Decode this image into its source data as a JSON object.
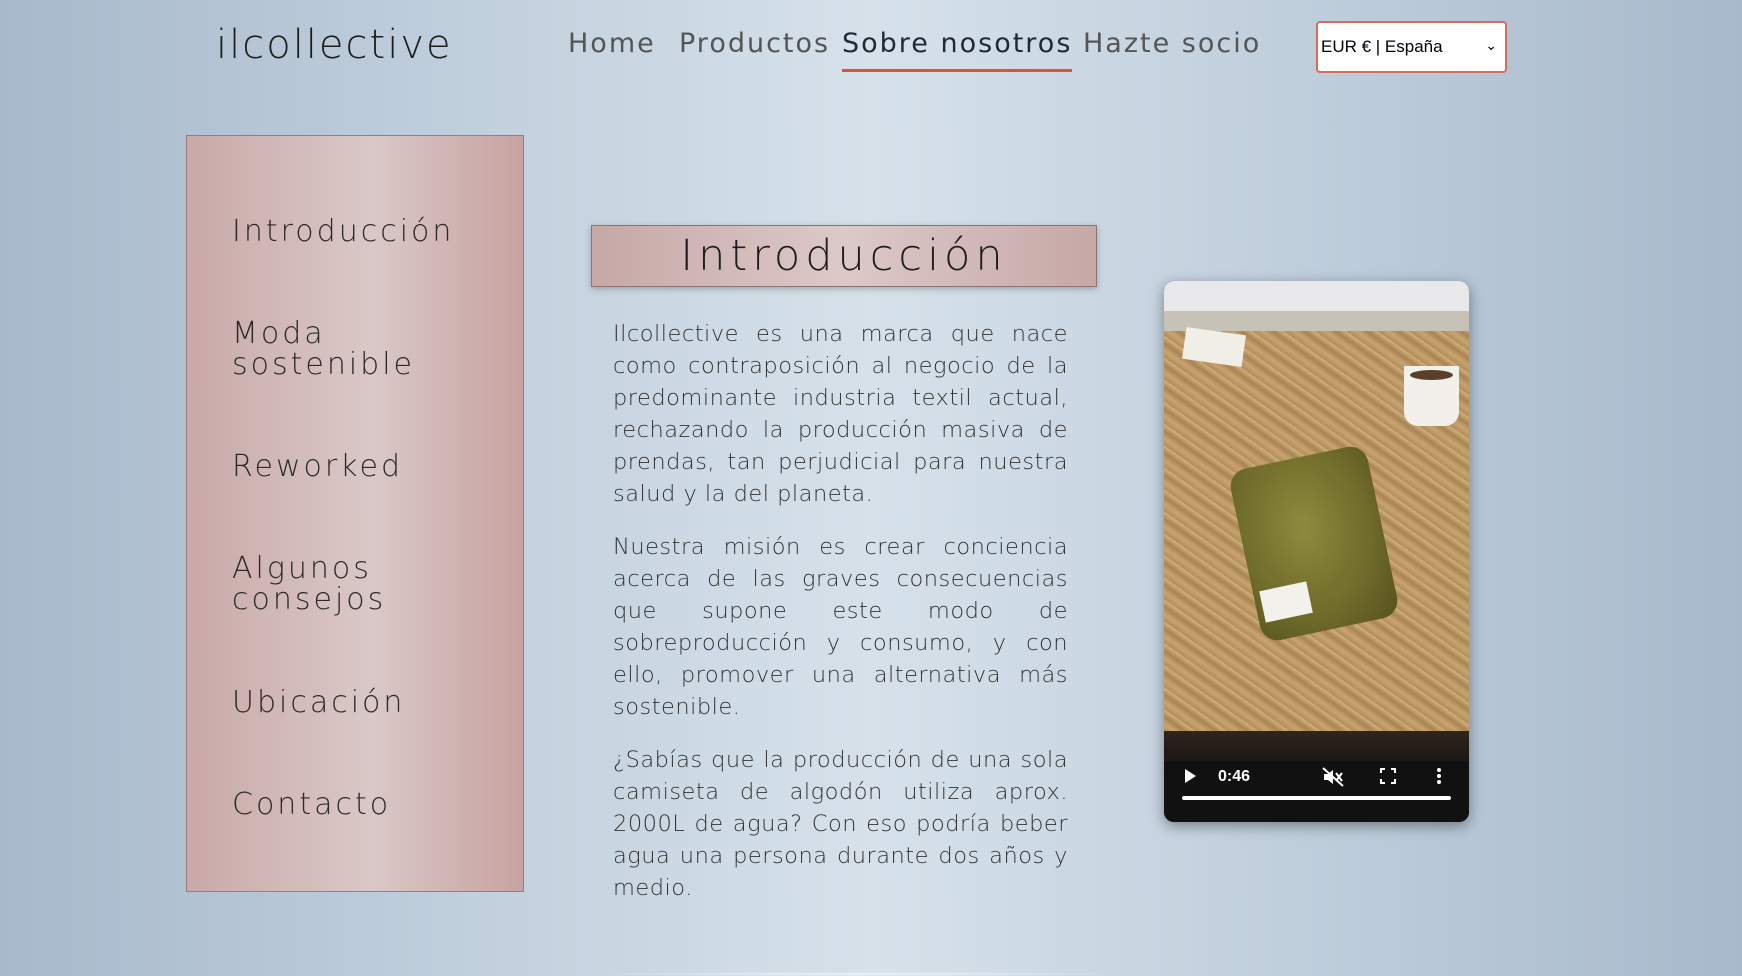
{
  "brand": {
    "logo": "ilcollective"
  },
  "nav": {
    "items": [
      {
        "label": "Home"
      },
      {
        "label": "Productos"
      },
      {
        "label": "Sobre nosotros",
        "active": true
      },
      {
        "label": "Hazte socio"
      }
    ]
  },
  "currency": {
    "selected": "EUR € | España"
  },
  "sidebar": {
    "items": [
      {
        "label": "Introducción"
      },
      {
        "label": "Moda sostenible"
      },
      {
        "label": "Reworked"
      },
      {
        "label": "Algunos consejos"
      },
      {
        "label": "Ubicación"
      },
      {
        "label": "Contacto"
      }
    ]
  },
  "main": {
    "title": "Introducción",
    "paragraphs": [
      "Ilcollective es una marca que nace como contraposición al negocio de la predominante industria textil actual, rechazando la producción masiva de prendas, tan perjudicial para nuestra salud y la del planeta.",
      "Nuestra misión es crear conciencia acerca de las graves consecuencias que supone este modo de sobreproducción y consumo, y con ello, promover una alternativa más sostenible.",
      "¿Sabías que la producción de una sola camiseta de algodón utiliza aprox. 2000L de agua? Con eso podría beber agua una persona durante dos años y medio."
    ]
  },
  "video": {
    "time": "0:46",
    "progress": 1.0,
    "icons": [
      "play-icon",
      "muted-icon",
      "fullscreen-icon",
      "more-options-icon"
    ]
  },
  "colors": {
    "accent": "#d9543f",
    "sidebar_bg": "#d3b9b7",
    "text": "#333333"
  }
}
